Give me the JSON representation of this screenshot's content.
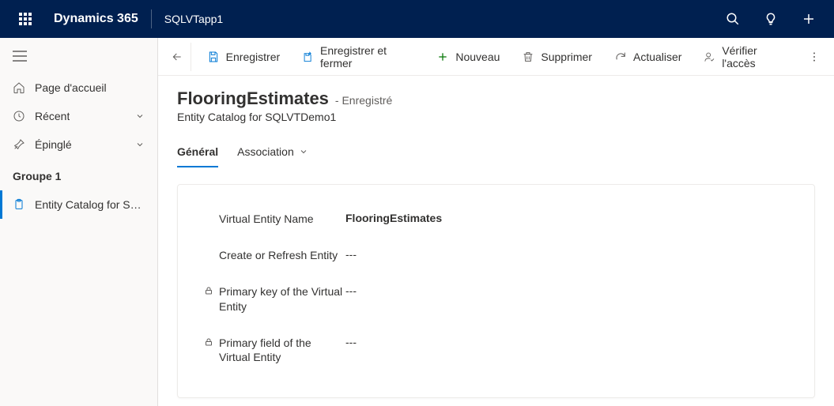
{
  "topbar": {
    "brand": "Dynamics 365",
    "app": "SQLVTapp1"
  },
  "sidebar": {
    "home": "Page d'accueil",
    "recent": "Récent",
    "pinned": "Épinglé",
    "group_title": "Groupe 1",
    "entity_catalog": "Entity Catalog for SQ…"
  },
  "commands": {
    "save": "Enregistrer",
    "save_close": "Enregistrer et fermer",
    "new": "Nouveau",
    "delete": "Supprimer",
    "refresh": "Actualiser",
    "check_access": "Vérifier l'accès"
  },
  "page": {
    "title": "FlooringEstimates",
    "status": "- Enregistré",
    "subtitle": "Entity Catalog for SQLVTDemo1"
  },
  "tabs": {
    "general": "Général",
    "association": "Association"
  },
  "fields": {
    "virtual_entity_name": {
      "label": "Virtual Entity Name",
      "value": "FlooringEstimates"
    },
    "create_or_refresh": {
      "label": "Create or Refresh Entity",
      "value": "---"
    },
    "primary_key": {
      "label": "Primary key of the Virtual Entity",
      "value": "---"
    },
    "primary_field": {
      "label": "Primary field of the Virtual Entity",
      "value": "---"
    }
  }
}
